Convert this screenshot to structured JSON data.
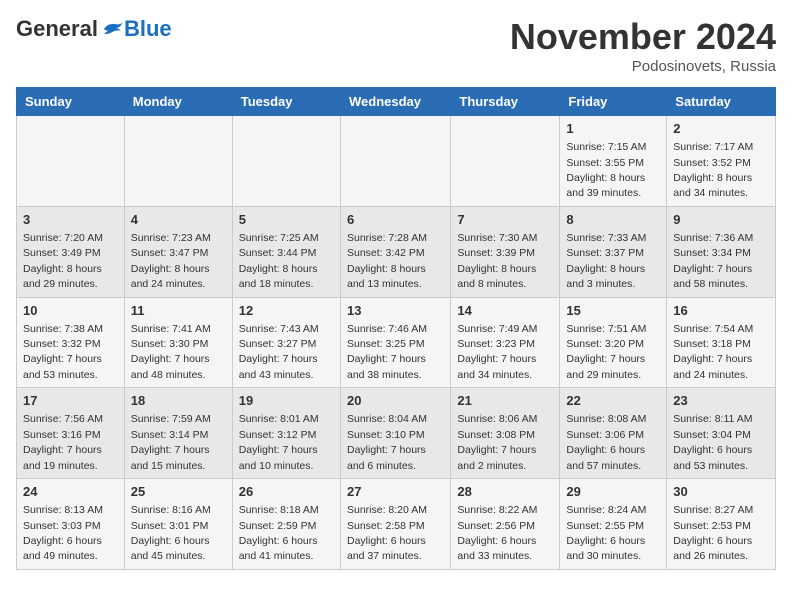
{
  "header": {
    "logo": {
      "general": "General",
      "blue": "Blue"
    },
    "title": "November 2024",
    "location": "Podosinovets, Russia"
  },
  "weekdays": [
    "Sunday",
    "Monday",
    "Tuesday",
    "Wednesday",
    "Thursday",
    "Friday",
    "Saturday"
  ],
  "weeks": [
    [
      null,
      null,
      null,
      null,
      null,
      {
        "day": "1",
        "sunrise": "Sunrise: 7:15 AM",
        "sunset": "Sunset: 3:55 PM",
        "daylight": "Daylight: 8 hours and 39 minutes."
      },
      {
        "day": "2",
        "sunrise": "Sunrise: 7:17 AM",
        "sunset": "Sunset: 3:52 PM",
        "daylight": "Daylight: 8 hours and 34 minutes."
      }
    ],
    [
      {
        "day": "3",
        "sunrise": "Sunrise: 7:20 AM",
        "sunset": "Sunset: 3:49 PM",
        "daylight": "Daylight: 8 hours and 29 minutes."
      },
      {
        "day": "4",
        "sunrise": "Sunrise: 7:23 AM",
        "sunset": "Sunset: 3:47 PM",
        "daylight": "Daylight: 8 hours and 24 minutes."
      },
      {
        "day": "5",
        "sunrise": "Sunrise: 7:25 AM",
        "sunset": "Sunset: 3:44 PM",
        "daylight": "Daylight: 8 hours and 18 minutes."
      },
      {
        "day": "6",
        "sunrise": "Sunrise: 7:28 AM",
        "sunset": "Sunset: 3:42 PM",
        "daylight": "Daylight: 8 hours and 13 minutes."
      },
      {
        "day": "7",
        "sunrise": "Sunrise: 7:30 AM",
        "sunset": "Sunset: 3:39 PM",
        "daylight": "Daylight: 8 hours and 8 minutes."
      },
      {
        "day": "8",
        "sunrise": "Sunrise: 7:33 AM",
        "sunset": "Sunset: 3:37 PM",
        "daylight": "Daylight: 8 hours and 3 minutes."
      },
      {
        "day": "9",
        "sunrise": "Sunrise: 7:36 AM",
        "sunset": "Sunset: 3:34 PM",
        "daylight": "Daylight: 7 hours and 58 minutes."
      }
    ],
    [
      {
        "day": "10",
        "sunrise": "Sunrise: 7:38 AM",
        "sunset": "Sunset: 3:32 PM",
        "daylight": "Daylight: 7 hours and 53 minutes."
      },
      {
        "day": "11",
        "sunrise": "Sunrise: 7:41 AM",
        "sunset": "Sunset: 3:30 PM",
        "daylight": "Daylight: 7 hours and 48 minutes."
      },
      {
        "day": "12",
        "sunrise": "Sunrise: 7:43 AM",
        "sunset": "Sunset: 3:27 PM",
        "daylight": "Daylight: 7 hours and 43 minutes."
      },
      {
        "day": "13",
        "sunrise": "Sunrise: 7:46 AM",
        "sunset": "Sunset: 3:25 PM",
        "daylight": "Daylight: 7 hours and 38 minutes."
      },
      {
        "day": "14",
        "sunrise": "Sunrise: 7:49 AM",
        "sunset": "Sunset: 3:23 PM",
        "daylight": "Daylight: 7 hours and 34 minutes."
      },
      {
        "day": "15",
        "sunrise": "Sunrise: 7:51 AM",
        "sunset": "Sunset: 3:20 PM",
        "daylight": "Daylight: 7 hours and 29 minutes."
      },
      {
        "day": "16",
        "sunrise": "Sunrise: 7:54 AM",
        "sunset": "Sunset: 3:18 PM",
        "daylight": "Daylight: 7 hours and 24 minutes."
      }
    ],
    [
      {
        "day": "17",
        "sunrise": "Sunrise: 7:56 AM",
        "sunset": "Sunset: 3:16 PM",
        "daylight": "Daylight: 7 hours and 19 minutes."
      },
      {
        "day": "18",
        "sunrise": "Sunrise: 7:59 AM",
        "sunset": "Sunset: 3:14 PM",
        "daylight": "Daylight: 7 hours and 15 minutes."
      },
      {
        "day": "19",
        "sunrise": "Sunrise: 8:01 AM",
        "sunset": "Sunset: 3:12 PM",
        "daylight": "Daylight: 7 hours and 10 minutes."
      },
      {
        "day": "20",
        "sunrise": "Sunrise: 8:04 AM",
        "sunset": "Sunset: 3:10 PM",
        "daylight": "Daylight: 7 hours and 6 minutes."
      },
      {
        "day": "21",
        "sunrise": "Sunrise: 8:06 AM",
        "sunset": "Sunset: 3:08 PM",
        "daylight": "Daylight: 7 hours and 2 minutes."
      },
      {
        "day": "22",
        "sunrise": "Sunrise: 8:08 AM",
        "sunset": "Sunset: 3:06 PM",
        "daylight": "Daylight: 6 hours and 57 minutes."
      },
      {
        "day": "23",
        "sunrise": "Sunrise: 8:11 AM",
        "sunset": "Sunset: 3:04 PM",
        "daylight": "Daylight: 6 hours and 53 minutes."
      }
    ],
    [
      {
        "day": "24",
        "sunrise": "Sunrise: 8:13 AM",
        "sunset": "Sunset: 3:03 PM",
        "daylight": "Daylight: 6 hours and 49 minutes."
      },
      {
        "day": "25",
        "sunrise": "Sunrise: 8:16 AM",
        "sunset": "Sunset: 3:01 PM",
        "daylight": "Daylight: 6 hours and 45 minutes."
      },
      {
        "day": "26",
        "sunrise": "Sunrise: 8:18 AM",
        "sunset": "Sunset: 2:59 PM",
        "daylight": "Daylight: 6 hours and 41 minutes."
      },
      {
        "day": "27",
        "sunrise": "Sunrise: 8:20 AM",
        "sunset": "Sunset: 2:58 PM",
        "daylight": "Daylight: 6 hours and 37 minutes."
      },
      {
        "day": "28",
        "sunrise": "Sunrise: 8:22 AM",
        "sunset": "Sunset: 2:56 PM",
        "daylight": "Daylight: 6 hours and 33 minutes."
      },
      {
        "day": "29",
        "sunrise": "Sunrise: 8:24 AM",
        "sunset": "Sunset: 2:55 PM",
        "daylight": "Daylight: 6 hours and 30 minutes."
      },
      {
        "day": "30",
        "sunrise": "Sunrise: 8:27 AM",
        "sunset": "Sunset: 2:53 PM",
        "daylight": "Daylight: 6 hours and 26 minutes."
      }
    ]
  ]
}
